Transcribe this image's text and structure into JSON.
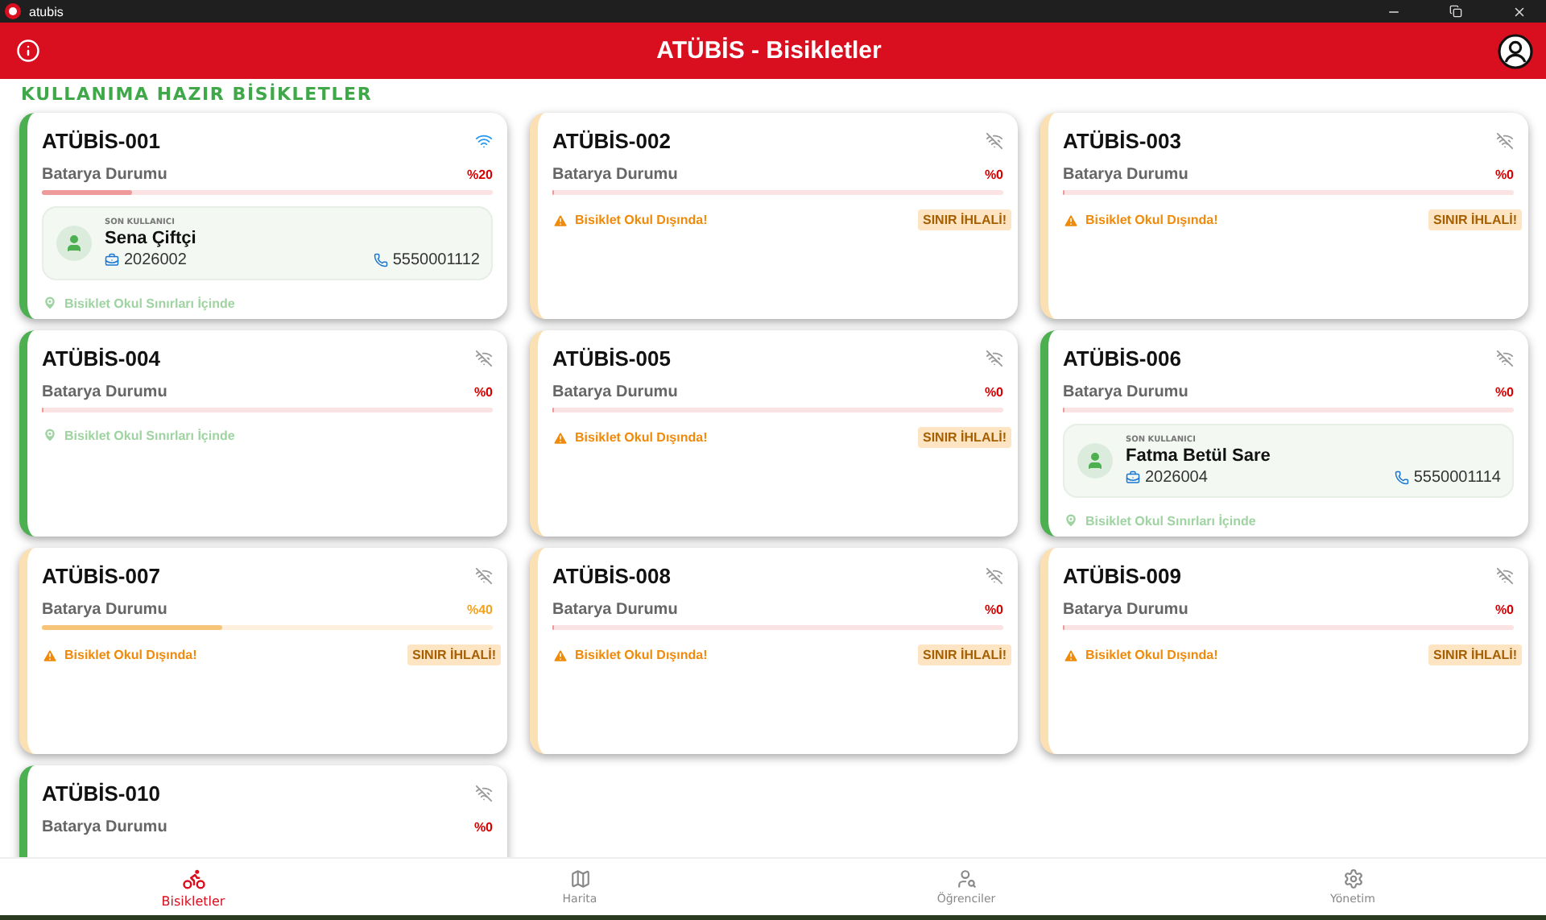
{
  "window": {
    "title": "atubis"
  },
  "app_bar": {
    "title": "ATÜBİS - Bisikletler"
  },
  "section_title": "KULLANIMA HAZIR BİSİKLETLER",
  "bikes": [
    {
      "name": "ATÜBİS-001",
      "online": true,
      "battery_label": "Batarya Durumu",
      "reading": "%20",
      "level": 0.2,
      "inside": true,
      "last_user": {
        "caption": "SON KULLANICI",
        "name": "Sena Çiftçi",
        "student_no": "2026002",
        "phone": "5550001112"
      },
      "location": "Bisiklet Okul Sınırları İçinde"
    },
    {
      "name": "ATÜBİS-002",
      "online": false,
      "battery_label": "Batarya Durumu",
      "reading": "%0",
      "level": 0,
      "inside": false,
      "location": "Bisiklet Okul Dışında!",
      "badge": "SINIR İHLALİ!"
    },
    {
      "name": "ATÜBİS-003",
      "online": false,
      "battery_label": "Batarya Durumu",
      "reading": "%0",
      "level": 0,
      "inside": false,
      "location": "Bisiklet Okul Dışında!",
      "badge": "SINIR İHLALİ!"
    },
    {
      "name": "ATÜBİS-004",
      "online": false,
      "battery_label": "Batarya Durumu",
      "reading": "%0",
      "level": 0,
      "inside": true,
      "location": "Bisiklet Okul Sınırları İçinde"
    },
    {
      "name": "ATÜBİS-005",
      "online": false,
      "battery_label": "Batarya Durumu",
      "reading": "%0",
      "level": 0,
      "inside": false,
      "location": "Bisiklet Okul Dışında!",
      "badge": "SINIR İHLALİ!"
    },
    {
      "name": "ATÜBİS-006",
      "online": false,
      "battery_label": "Batarya Durumu",
      "reading": "%0",
      "level": 0,
      "inside": true,
      "last_user": {
        "caption": "SON KULLANICI",
        "name": "Fatma Betül Sare",
        "student_no": "2026004",
        "phone": "5550001114"
      },
      "location": "Bisiklet Okul Sınırları İçinde"
    },
    {
      "name": "ATÜBİS-007",
      "online": false,
      "battery_label": "Batarya Durumu",
      "reading": "%40",
      "level": 0.4,
      "inside": false,
      "location": "Bisiklet Okul Dışında!",
      "badge": "SINIR İHLALİ!"
    },
    {
      "name": "ATÜBİS-008",
      "online": false,
      "battery_label": "Batarya Durumu",
      "reading": "%0",
      "level": 0,
      "inside": false,
      "location": "Bisiklet Okul Dışında!",
      "badge": "SINIR İHLALİ!"
    },
    {
      "name": "ATÜBİS-009",
      "online": false,
      "battery_label": "Batarya Durumu",
      "reading": "%0",
      "level": 0,
      "inside": false,
      "location": "Bisiklet Okul Dışında!",
      "badge": "SINIR İHLALİ!"
    },
    {
      "name": "ATÜBİS-010",
      "online": false,
      "battery_label": "Batarya Durumu",
      "reading": "%0",
      "inside": true
    }
  ],
  "nav": [
    {
      "kind": "bikes",
      "label": "Bisikletler",
      "selected": true
    },
    {
      "kind": "map",
      "label": "Harita",
      "selected": false
    },
    {
      "kind": "students",
      "label": "Öğrenciler",
      "selected": false
    },
    {
      "kind": "admin",
      "label": "Yönetim",
      "selected": false
    }
  ]
}
